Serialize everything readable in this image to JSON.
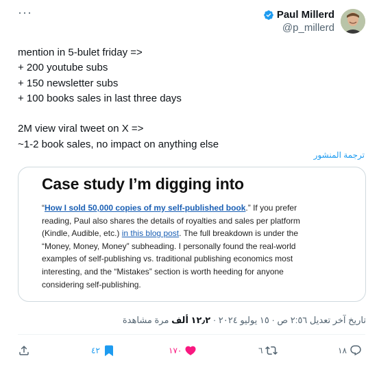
{
  "header": {
    "more_label": "···",
    "display_name": "Paul Millerd",
    "handle": "@p_millerd",
    "avatar_icon": "user-avatar-icon",
    "verified_icon": "verified-badge-icon"
  },
  "tweet": {
    "lines": [
      "mention in 5-bulet friday =>",
      "+ 200 youtube subs",
      "+ 150 newsletter subs",
      "+ 100 books sales in last three days",
      "",
      "2M view viral tweet on X =>",
      "~1-2 book sales, no impact on anything else"
    ],
    "translate_label": "ترجمة المنشور"
  },
  "card": {
    "title": "Case study I’m digging into",
    "p_open_quote": "“",
    "link1": "How I sold 50,000 copies of my self-published book",
    "after_link1": ".” If you prefer",
    "line2": "reading, Paul also shares the details of royalties and sales per platform",
    "line3_before": "(Kindle, Audible, etc.) ",
    "link2": "in this blog post",
    "line3_after": ". The full breakdown is under the",
    "line4": "“Money, Money, Money” subheading. I personally found the real-world",
    "line5": "examples of self-publishing vs. traditional publishing economics most",
    "line6": "interesting, and the “Mistakes” section is worth heeding for anyone",
    "line7": "considering self-publishing."
  },
  "meta": {
    "timestamp": "تاريخ آخر تعديل ٢:٥٦ ص · ١٥ يوليو ٢٠٢٤ ·",
    "views_count": "١٢٫٢ ألف",
    "views_label": "مرة مشاهدة"
  },
  "actions": {
    "reply_count": "١٨",
    "retweet_count": "٦",
    "like_count": "١٧٠",
    "bookmark_count": "٤٢",
    "colors": {
      "like": "#f91880",
      "bookmark": "#1d9bf0",
      "icon": "#536471"
    }
  }
}
